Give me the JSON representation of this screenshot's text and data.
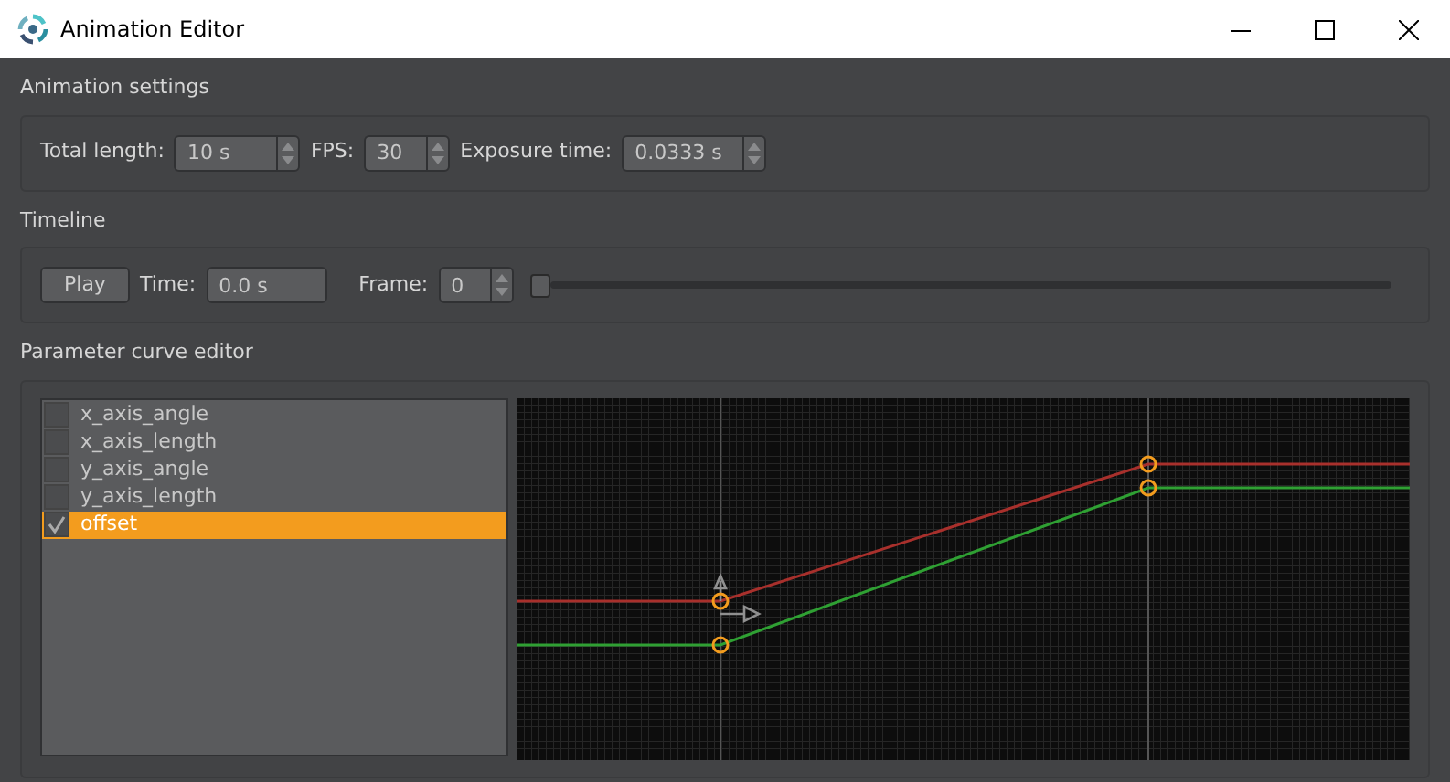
{
  "window": {
    "title": "Animation Editor"
  },
  "animation_settings": {
    "title": "Animation settings",
    "fields": [
      {
        "label": "Total length:",
        "value": "10 s",
        "kind": "spin"
      },
      {
        "label": "FPS:",
        "value": "30",
        "kind": "spin"
      },
      {
        "label": "Exposure time:",
        "value": "0.0333 s",
        "kind": "spin"
      }
    ]
  },
  "timeline": {
    "title": "Timeline",
    "play": "Play",
    "fields": [
      {
        "label": "Time:",
        "value": "0.0 s",
        "kind": "text"
      },
      {
        "label": "Frame:",
        "value": "0",
        "kind": "spin"
      }
    ],
    "slider": {
      "level": 0
    }
  },
  "curve_editor": {
    "title": "Parameter curve editor",
    "parameters": [
      {
        "name": "x_axis_angle",
        "checked": false,
        "selected": false
      },
      {
        "name": "x_axis_length",
        "checked": false,
        "selected": false
      },
      {
        "name": "y_axis_angle",
        "checked": false,
        "selected": false
      },
      {
        "name": "y_axis_length",
        "checked": false,
        "selected": false
      },
      {
        "name": "offset",
        "checked": true,
        "selected": true
      }
    ]
  }
}
